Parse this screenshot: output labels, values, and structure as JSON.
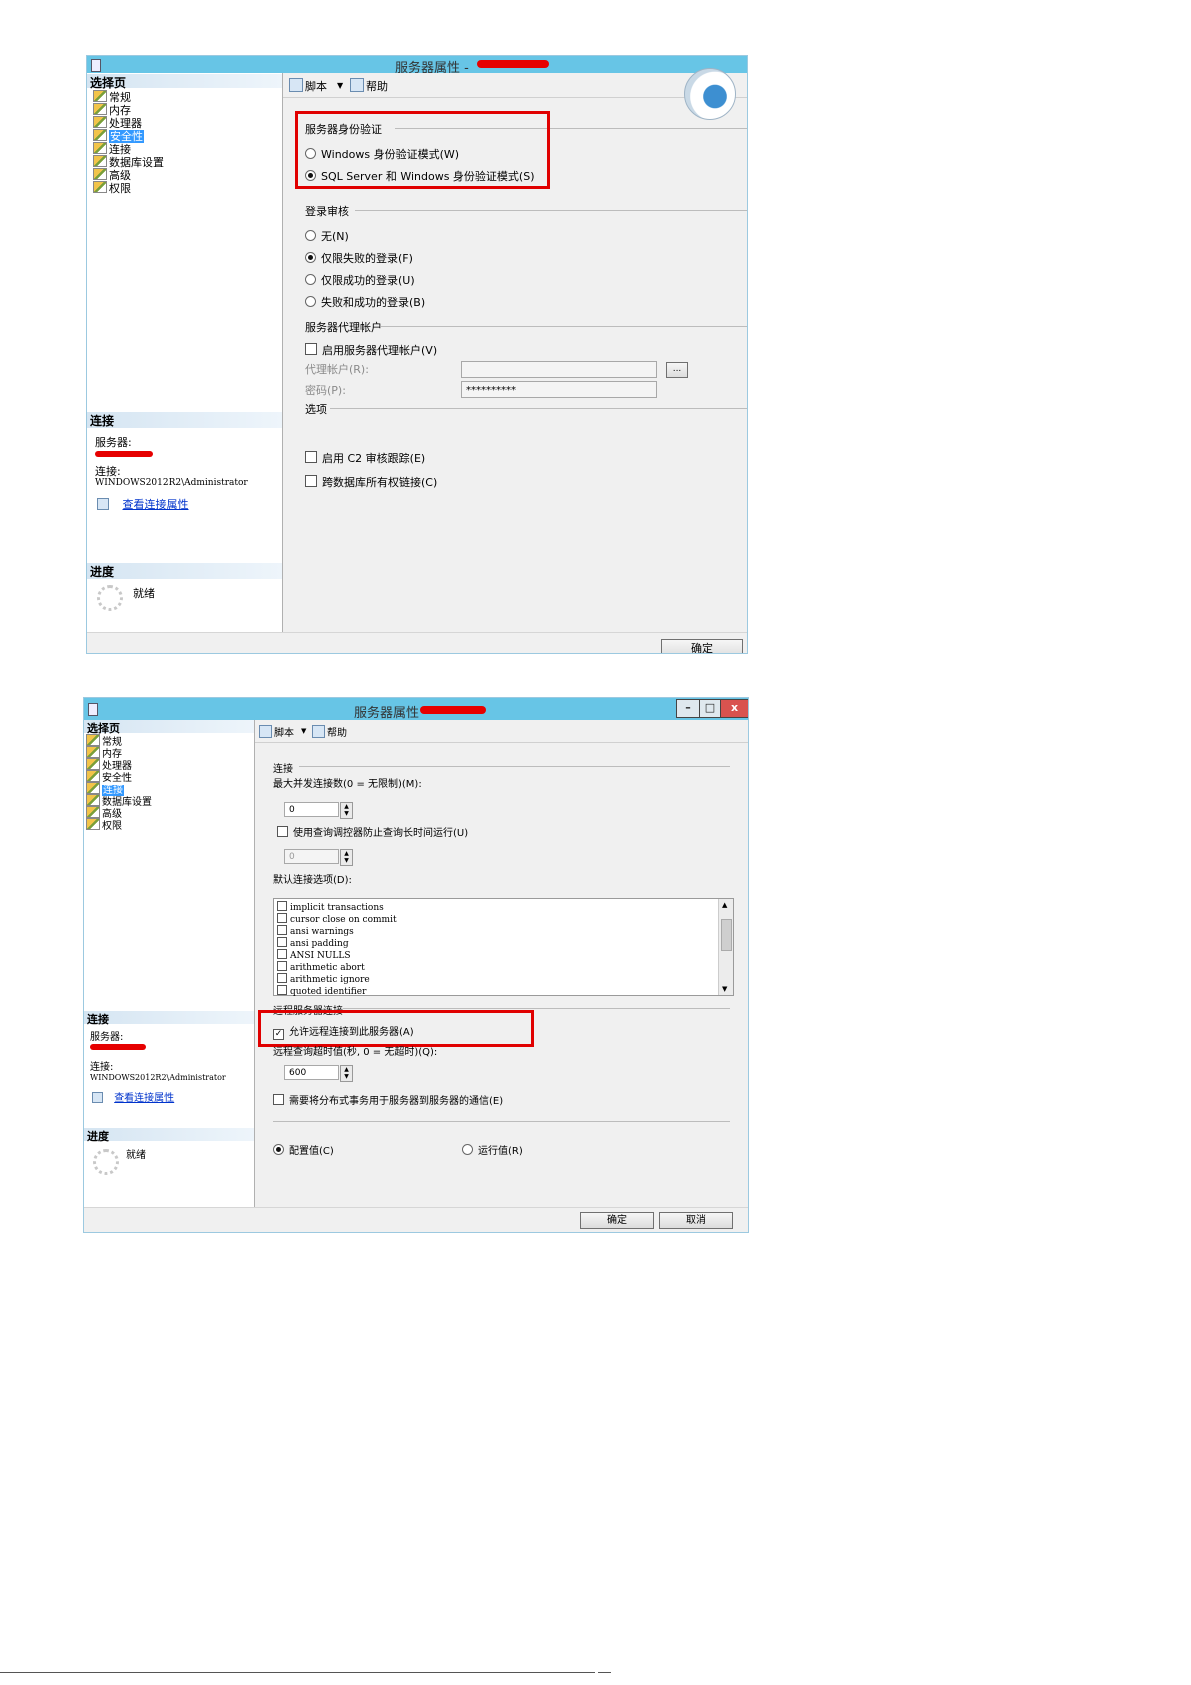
{
  "window": {
    "title": "服务器属性 -",
    "minimize": "–",
    "maximize": "□",
    "close": "x"
  },
  "colors": {
    "titlebar": "#67c5e6",
    "highlight_box": "#e00000",
    "selection": "#3399ff",
    "link": "#0033cc"
  },
  "left_pane": {
    "select_page_header": "选择页",
    "pages": [
      "常规",
      "内存",
      "处理器",
      "安全性",
      "连接",
      "数据库设置",
      "高级",
      "权限"
    ],
    "connection_header": "连接",
    "server_label": "服务器:",
    "connection_label": "连接:",
    "connection_value": "WINDOWS2012R2\\Administrator",
    "view_conn_props": "查看连接属性",
    "progress_header": "进度",
    "progress_status": "就绪"
  },
  "toolbar": {
    "script_label": "脚本",
    "dropdown_arrow": "▼",
    "help_label": "帮助"
  },
  "security_page": {
    "auth_group": "服务器身份验证",
    "auth_windows": "Windows 身份验证模式(W)",
    "auth_mixed": "SQL Server 和 Windows 身份验证模式(S)",
    "auth_selected": "mixed",
    "audit_group": "登录审核",
    "audit_options": [
      "无(N)",
      "仅限失败的登录(F)",
      "仅限成功的登录(U)",
      "失败和成功的登录(B)"
    ],
    "audit_selected_index": 1,
    "proxy_group": "服务器代理帐户",
    "proxy_enable": "启用服务器代理帐户(V)",
    "proxy_account_label": "代理帐户(R):",
    "proxy_browse": "...",
    "password_label": "密码(P):",
    "password_value": "**********",
    "options_group": "选项",
    "c2_audit": "启用 C2 审核跟踪(E)",
    "cross_db_chaining": "跨数据库所有权链接(C)"
  },
  "connection_page": {
    "conn_group": "连接",
    "max_conn_label": "最大并发连接数(0 = 无限制)(M):",
    "max_conn_value": "0",
    "query_governor_label": "使用查询调控器防止查询长时间运行(U)",
    "query_governor_value": "0",
    "default_options_label": "默认连接选项(D):",
    "default_options": [
      "implicit transactions",
      "cursor close on commit",
      "ansi warnings",
      "ansi padding",
      "ANSI NULLS",
      "arithmetic abort",
      "arithmetic ignore",
      "quoted identifier"
    ],
    "remote_group": "远程服务器连接",
    "allow_remote": "允许远程连接到此服务器(A)",
    "allow_remote_checked": true,
    "remote_timeout_label": "远程查询超时值(秒, 0 = 无超时)(Q):",
    "remote_timeout_value": "600",
    "distributed_tx": "需要将分布式事务用于服务器到服务器的通信(E)",
    "configured_values": "配置值(C)",
    "running_values": "运行值(R)",
    "ok": "确定",
    "cancel": "取消"
  }
}
